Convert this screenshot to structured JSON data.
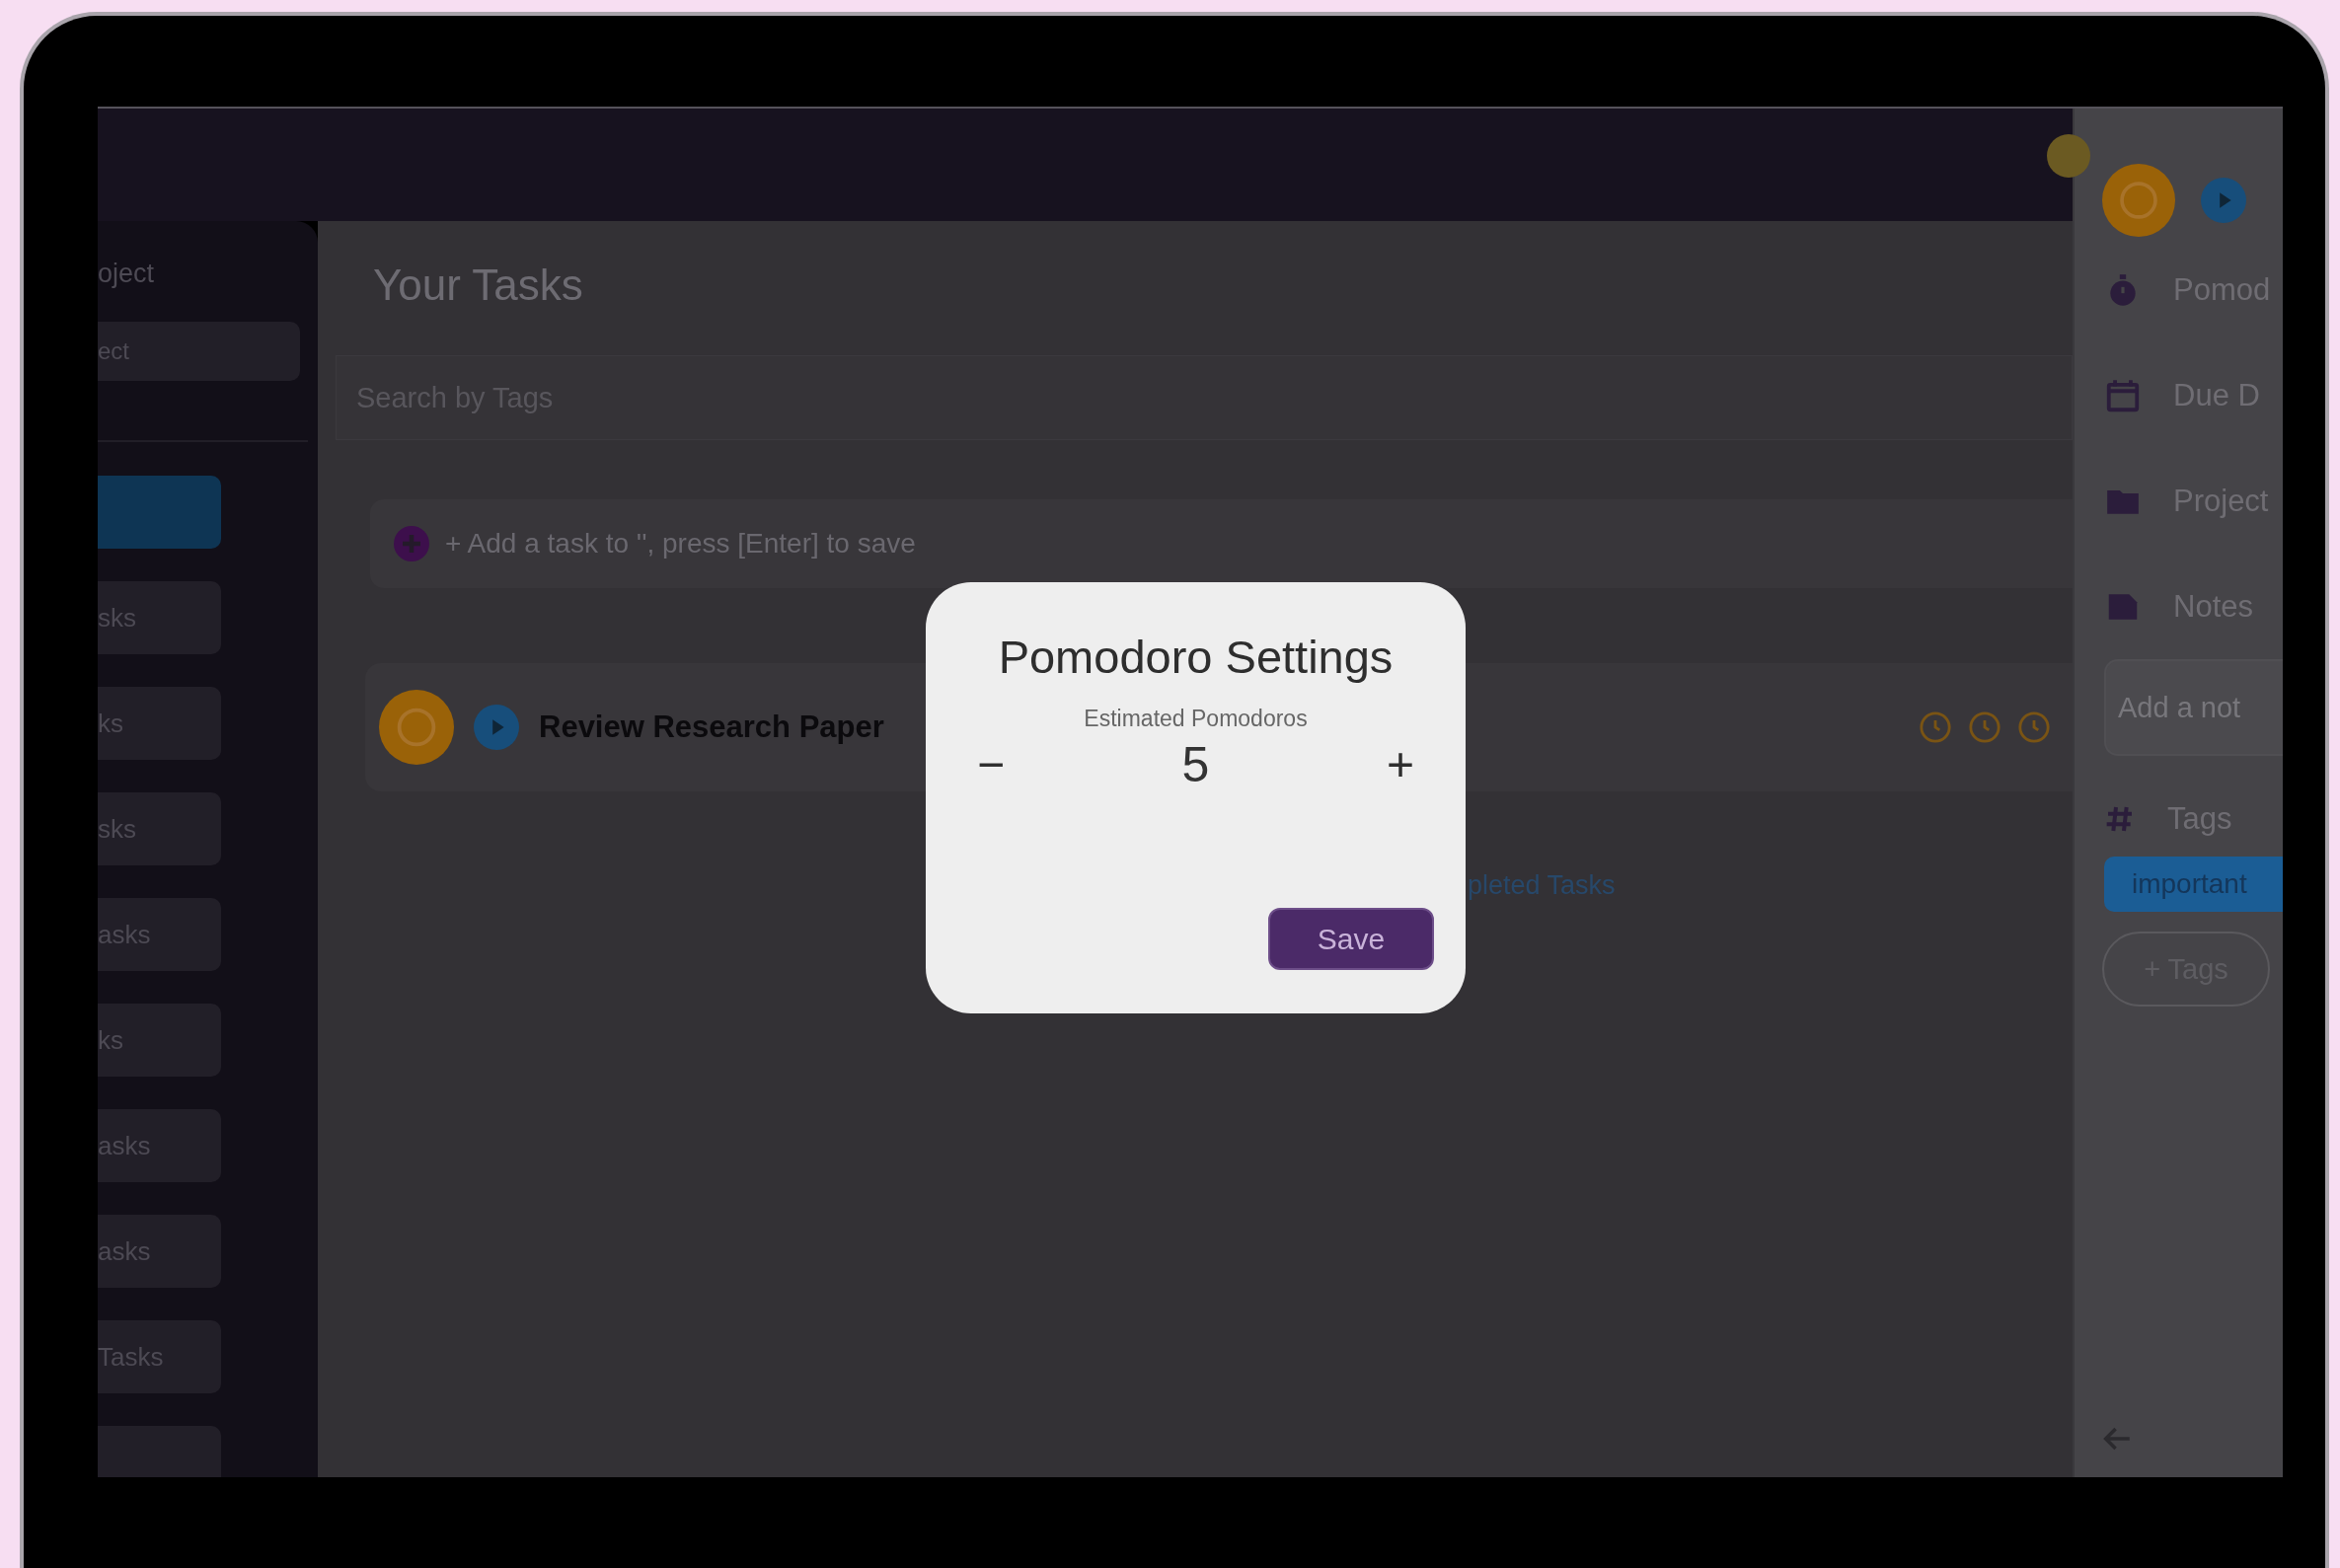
{
  "sidebar": {
    "heading": "oject",
    "project_field": {
      "value": "ect"
    },
    "items": [
      {
        "selected": true
      },
      {
        "label": "sks",
        "selected": false
      },
      {
        "label": "ks",
        "selected": false
      },
      {
        "label": "sks",
        "selected": false
      },
      {
        "label": "asks",
        "selected": false
      },
      {
        "label": "ks",
        "selected": false
      },
      {
        "label": "asks",
        "selected": false
      },
      {
        "label": "asks",
        "selected": false
      },
      {
        "label": "Tasks",
        "selected": false
      },
      {
        "selected": false
      }
    ]
  },
  "main": {
    "title": "Your Tasks",
    "search": {
      "placeholder": "Search by Tags"
    },
    "add_task": {
      "placeholder": "+ Add a task to '', press [Enter] to save"
    },
    "tasks": [
      {
        "title": "Review Research Paper",
        "pomodoro_marks": [
          {
            "done": false
          },
          {
            "done": false
          },
          {
            "done": false
          }
        ]
      }
    ],
    "completed_link": "pleted Tasks"
  },
  "detail": {
    "items": [
      {
        "kind": "timer",
        "label": "Pomod"
      },
      {
        "kind": "calendar",
        "label": "Due D"
      },
      {
        "kind": "folder",
        "label": "Project"
      },
      {
        "kind": "note",
        "label": "Notes"
      }
    ],
    "note_field": {
      "placeholder": "Add a not"
    },
    "tags_label": "Tags",
    "tags": [
      "important"
    ],
    "add_tag_button": "+ Tags"
  },
  "dialog": {
    "title": "Pomodoro Settings",
    "label": "Estimated Pomodoros",
    "decrement": "−",
    "value": "5",
    "increment": "+",
    "save": "Save"
  }
}
